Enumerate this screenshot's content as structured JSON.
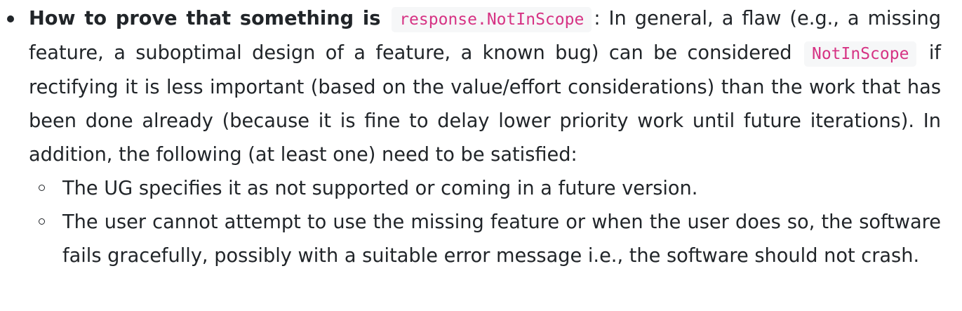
{
  "item": {
    "lead_text": "How to prove that something is ",
    "lead_code": "response.NotInScope",
    "text_1": ": In general, a flaw (e.g., a missing feature, a suboptimal design of a feature, a known bug) can be considered ",
    "inline_code": "NotInScope",
    "text_2": " if rectifying it is less important (based on the value/effort considerations) than the work that has been done already (because it is fine to delay lower priority work until future iterations). In addition, the following (at least one) need to be satisfied:",
    "sub_items": [
      "The UG specifies it as not supported or coming in a future version.",
      "The user cannot attempt to use the missing feature or when the user does so, the software fails gracefully, possibly with a suitable error message i.e., the software should not crash."
    ]
  }
}
